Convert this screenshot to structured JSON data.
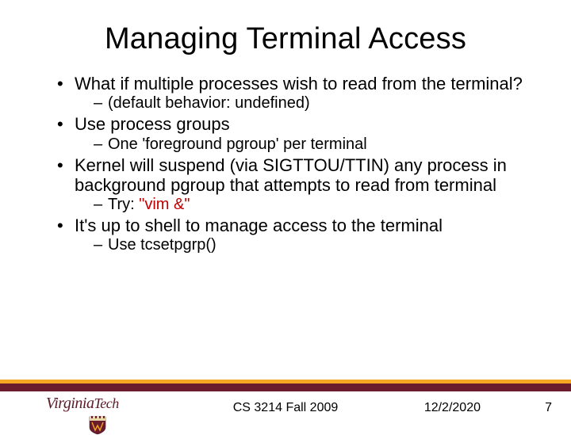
{
  "title": "Managing Terminal Access",
  "bullets": [
    {
      "text": "What if multiple processes wish to read from the terminal?",
      "sub": [
        {
          "text": "(default behavior: undefined)"
        }
      ]
    },
    {
      "text": "Use process groups",
      "sub": [
        {
          "text": "One 'foreground pgroup' per terminal"
        }
      ]
    },
    {
      "text": "Kernel will suspend (via SIGTTOU/TTIN) any process in background pgroup that attempts to read from terminal",
      "sub": [
        {
          "prefix": "Try: ",
          "cmd": "\"vim &\""
        }
      ]
    },
    {
      "text": "It's up to shell to manage access to the terminal",
      "sub": [
        {
          "text": "Use tcsetpgrp()"
        }
      ]
    }
  ],
  "logo": {
    "text_a": "Virginia",
    "text_b": "Tech"
  },
  "footer": {
    "course": "CS 3214 Fall 2009",
    "date": "12/2/2020",
    "page": "7"
  },
  "colors": {
    "accent_orange": "#f5a623",
    "accent_maroon": "#6b1c2c",
    "cmd_red": "#c00000"
  }
}
